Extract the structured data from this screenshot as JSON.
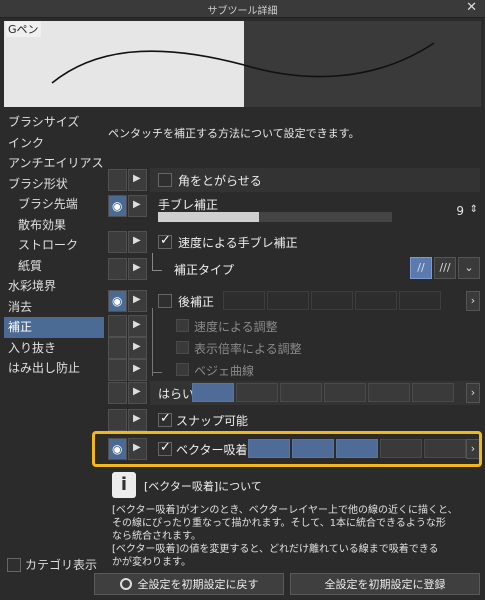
{
  "window": {
    "title": "サブツール詳細",
    "close": "✕"
  },
  "preview": {
    "label": "Gペン"
  },
  "sidebar": {
    "items": [
      {
        "label": "ブラシサイズ",
        "sub": false,
        "selected": false
      },
      {
        "label": "インク",
        "sub": false,
        "selected": false
      },
      {
        "label": "アンチエイリアス",
        "sub": false,
        "selected": false
      },
      {
        "label": "ブラシ形状",
        "sub": false,
        "selected": false
      },
      {
        "label": "ブラシ先端",
        "sub": true,
        "selected": false
      },
      {
        "label": "散布効果",
        "sub": true,
        "selected": false
      },
      {
        "label": "ストローク",
        "sub": true,
        "selected": false
      },
      {
        "label": "紙質",
        "sub": true,
        "selected": false
      },
      {
        "label": "水彩境界",
        "sub": false,
        "selected": false
      },
      {
        "label": "消去",
        "sub": false,
        "selected": false
      },
      {
        "label": "補正",
        "sub": false,
        "selected": true
      },
      {
        "label": "入り抜き",
        "sub": false,
        "selected": false
      },
      {
        "label": "はみ出し防止",
        "sub": false,
        "selected": false
      }
    ],
    "category_label": "カテゴリ表示"
  },
  "main": {
    "description": "ペンタッチを補正する方法について設定できます。",
    "rows": {
      "kado": "角をとがらせる",
      "tebure": "手ブレ補正",
      "tebure_value": "9",
      "tebure_fraction": 0.43,
      "sokudo": "速度による手ブレ補正",
      "hosei_type": "補正タイプ",
      "ato": "後補正",
      "sokudo_chosei": "速度による調整",
      "bairitsu": "表示倍率による調整",
      "bezier": "ベジェ曲線",
      "harai": "はらい",
      "snap": "スナップ可能",
      "vector": "ベクター吸着"
    },
    "arrow": "›"
  },
  "info": {
    "icon": "i",
    "title": "[ベクター吸着]について",
    "line1": "[ベクター吸着]がオンのとき、ベクターレイヤー上で他の線の近くに描くと、",
    "line2": "その線にぴったり重なって描かれます。そして、1本に統合できるような形",
    "line3": "なら統合されます。",
    "line4": "[ベクター吸着]の値を変更すると、どれだけ離れている線まで吸着できる",
    "line5": "かが変わります。"
  },
  "buttons": {
    "reset": "全設定を初期設定に戻す",
    "register": "全設定を初期設定に登録"
  },
  "colors": {
    "accent": "#4b6a94",
    "highlight": "#f2b61f"
  }
}
